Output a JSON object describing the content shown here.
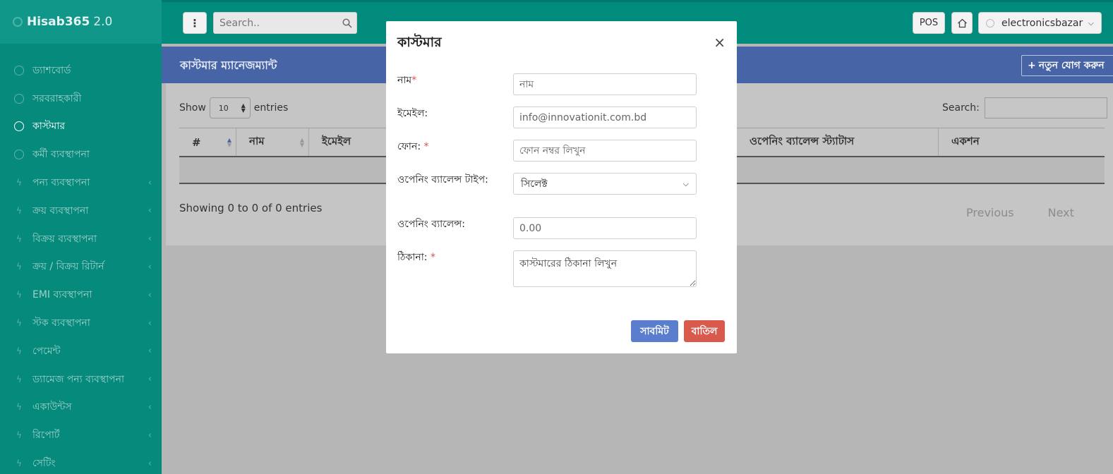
{
  "brand": {
    "name": "Hisab365",
    "version": "2.0"
  },
  "sidebar": {
    "items": [
      {
        "label": "ড্যাশবোর্ড",
        "icon": "gauge-icon",
        "active": false,
        "has_submenu": false
      },
      {
        "label": "সরবরাহকারী",
        "icon": "gauge-icon",
        "active": false,
        "has_submenu": false
      },
      {
        "label": "কাস্টমার",
        "icon": "gauge-icon",
        "active": true,
        "has_submenu": false
      },
      {
        "label": "কর্মী ব্যবস্থাপনা",
        "icon": "gauge-icon",
        "active": false,
        "has_submenu": false
      },
      {
        "label": "পন্য ব্যবস্থাপনা",
        "icon": "bolt-icon",
        "active": false,
        "has_submenu": true
      },
      {
        "label": "ক্রয় ব্যবস্থাপনা",
        "icon": "bolt-icon",
        "active": false,
        "has_submenu": true
      },
      {
        "label": "বিক্রয় ব্যবস্থাপনা",
        "icon": "bolt-icon",
        "active": false,
        "has_submenu": true
      },
      {
        "label": "ক্রয় / বিক্রয় রিটার্ন",
        "icon": "bolt-icon",
        "active": false,
        "has_submenu": true
      },
      {
        "label": "EMI ব্যবস্থাপনা",
        "icon": "bolt-icon",
        "active": false,
        "has_submenu": true
      },
      {
        "label": "স্টক ব্যবস্থাপনা",
        "icon": "bolt-icon",
        "active": false,
        "has_submenu": true
      },
      {
        "label": "পেমেন্ট",
        "icon": "bolt-icon",
        "active": false,
        "has_submenu": true
      },
      {
        "label": "ড্যামেজ পন্য ব্যবস্থাপনা",
        "icon": "bolt-icon",
        "active": false,
        "has_submenu": true
      },
      {
        "label": "একাউন্টস",
        "icon": "bolt-icon",
        "active": false,
        "has_submenu": true
      },
      {
        "label": "রিপোর্ট",
        "icon": "bolt-icon",
        "active": false,
        "has_submenu": true
      },
      {
        "label": "সেটিং",
        "icon": "bolt-icon",
        "active": false,
        "has_submenu": true
      }
    ]
  },
  "topbar": {
    "search_placeholder": "Search..",
    "pos_label": "POS",
    "username": "electronicsbazar"
  },
  "page": {
    "title": "কাস্টমার ম্যানেজম্যান্ট",
    "add_button": "নতুন যোগ করুন"
  },
  "table": {
    "show_label": "Show",
    "page_length": "10",
    "entries_label": "entries",
    "search_label": "Search:",
    "columns": [
      "#",
      "নাম",
      "ইমেইল",
      "",
      "ওপেনিং ব্যালেন্স স্ট্যাটাস",
      "একশন"
    ],
    "info": "Showing 0 to 0 of 0 entries",
    "prev_label": "Previous",
    "next_label": "Next"
  },
  "modal": {
    "title": "কাস্টমার",
    "close": "×",
    "fields": {
      "name": {
        "label": "নাম",
        "required": "*",
        "placeholder": "নাম"
      },
      "email": {
        "label": "ইমেইল:",
        "placeholder": "info@innovationit.com.bd"
      },
      "phone": {
        "label": "ফোন: ",
        "required": "*",
        "placeholder": "ফোন নম্বর লিখুন"
      },
      "balance_type": {
        "label": "ওপেনিং ব্যালেন্স টাইপ:",
        "selected": "সিলেক্ট"
      },
      "balance": {
        "label": "ওপেনিং ব্যালেন্স:",
        "placeholder": "0.00"
      },
      "address": {
        "label": "ঠিকানা: ",
        "required": "*",
        "placeholder": "কাস্টমারের ঠিকানা লিখুন"
      }
    },
    "submit_label": "সাবমিট",
    "cancel_label": "বাতিল"
  },
  "colors": {
    "sidebar": "#068a7c",
    "topbar": "#008b7d",
    "header": "#4764a6",
    "submit": "#5a7dcd",
    "cancel": "#d9594c",
    "required": "#d9534f"
  }
}
